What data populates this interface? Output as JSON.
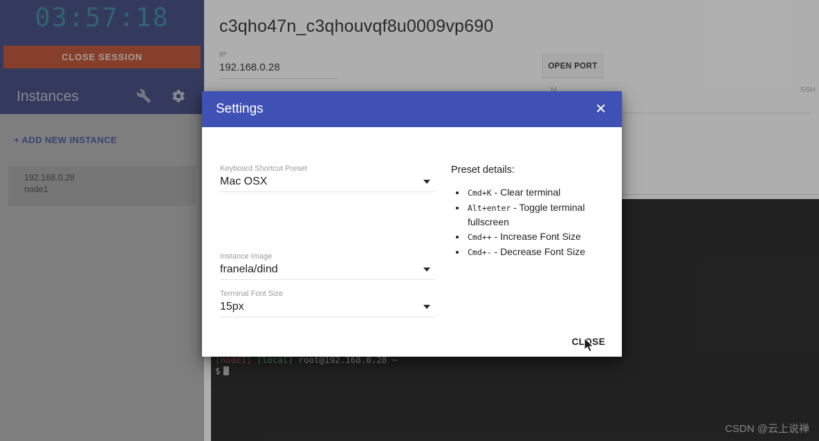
{
  "sidebar": {
    "timer": "03:57:18",
    "close_session_label": "CLOSE SESSION",
    "instances_title": "Instances",
    "wrench_icon": "wrench-icon",
    "gear_icon": "gear-icon",
    "add_instance_label": "+ ADD NEW INSTANCE",
    "instances": [
      {
        "ip": "192.168.0.28",
        "name": "node1"
      }
    ]
  },
  "main": {
    "session_id": "c3qho47n_c3qhouvqf8u0009vp690",
    "ip_field": {
      "label": "IP",
      "value": "192.168.0.28"
    },
    "open_port_label": "OPEN PORT",
    "ghost_label_1": "M",
    "ghost_label_2": "SSH",
    "terminal": {
      "host": "[node1]",
      "local": "(local)",
      "user": "root@192.168.0.28",
      "path": "~",
      "prompt": "$"
    },
    "watermark": "CSDN @云上说禅"
  },
  "modal": {
    "title": "Settings",
    "close_icon": "close-icon",
    "fields": [
      {
        "label": "Keyboard Shortcut Preset",
        "value": "Mac OSX"
      },
      {
        "label": "Instance Image",
        "value": "franela/dind"
      },
      {
        "label": "Terminal Font Size",
        "value": "15px"
      }
    ],
    "preset_details_title": "Preset details:",
    "preset_details": [
      {
        "key": "Cmd+K",
        "sep": " - ",
        "desc": "Clear terminal"
      },
      {
        "key": "Alt+enter",
        "sep": " - ",
        "desc": "Toggle terminal fullscreen"
      },
      {
        "key": "Cmd++",
        "sep": " - ",
        "desc": "Increase Font Size"
      },
      {
        "key": "Cmd+-",
        "sep": " - ",
        "desc": "Decrease Font Size"
      }
    ],
    "close_button_label": "CLOSE"
  },
  "colors": {
    "primary": "#3f51b5",
    "sidebar_header": "#2f3a73",
    "danger": "#b8411f",
    "timer_text": "#2d7e93",
    "link": "#3b4a96",
    "terminal_bg": "#101010"
  }
}
